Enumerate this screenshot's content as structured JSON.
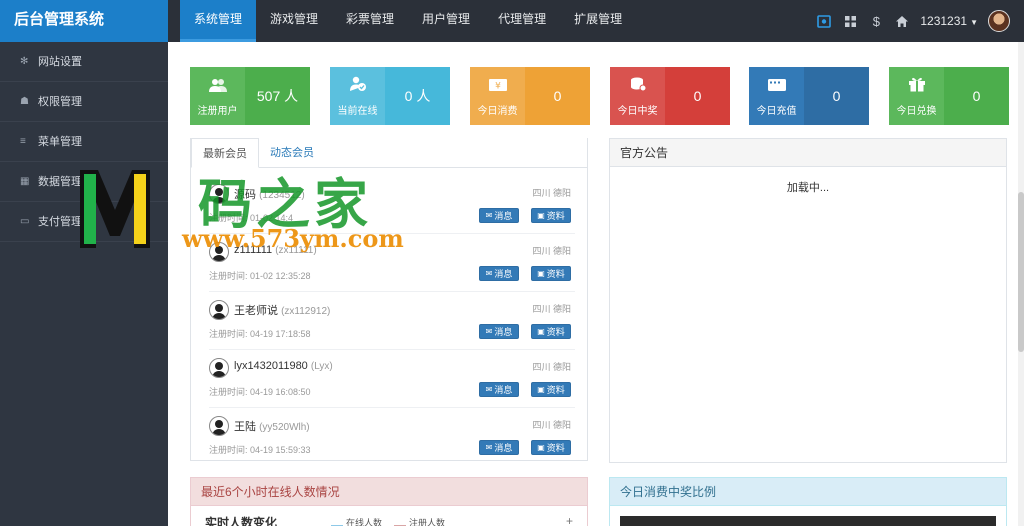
{
  "app": {
    "title": "后台管理系统"
  },
  "nav": {
    "items": [
      {
        "label": "系统管理",
        "active": true
      },
      {
        "label": "游戏管理",
        "active": false
      },
      {
        "label": "彩票管理",
        "active": false
      },
      {
        "label": "用户管理",
        "active": false
      },
      {
        "label": "代理管理",
        "active": false
      },
      {
        "label": "扩展管理",
        "active": false
      }
    ]
  },
  "topbar": {
    "icons": [
      "monitor-icon",
      "gift-icon",
      "dollar-icon",
      "home-icon"
    ],
    "username": "1231231"
  },
  "sidebar": {
    "items": [
      {
        "label": "网站设置",
        "icon": "gear-icon"
      },
      {
        "label": "权限管理",
        "icon": "users-icon"
      },
      {
        "label": "菜单管理",
        "icon": "list-icon"
      },
      {
        "label": "数据管理",
        "icon": "table-icon"
      },
      {
        "label": "支付管理",
        "icon": "card-icon"
      }
    ]
  },
  "stats": [
    {
      "label": "注册用户",
      "value": "507 人",
      "icon": "users-icon",
      "color_left": "#5cb85c",
      "color_right": "#4cae4c"
    },
    {
      "label": "当前在线",
      "value": "0 人",
      "icon": "user-check-icon",
      "color_left": "#5bc0de",
      "color_right": "#46b8da"
    },
    {
      "label": "今日消费",
      "value": "0",
      "icon": "ticket-icon",
      "color_left": "#f0ad4e",
      "color_right": "#eea236"
    },
    {
      "label": "今日中奖",
      "value": "0",
      "icon": "coins-icon",
      "color_left": "#d9534f",
      "color_right": "#d43f3a"
    },
    {
      "label": "今日充值",
      "value": "0",
      "icon": "wallet-icon",
      "color_left": "#337ab7",
      "color_right": "#2e6da4"
    },
    {
      "label": "今日兑换",
      "value": "0",
      "icon": "gift-icon",
      "color_left": "#5cb85c",
      "color_right": "#4cae4c"
    }
  ],
  "members_panel": {
    "tabs": [
      {
        "label": "最新会员",
        "active": true
      },
      {
        "label": "动态会员",
        "active": false
      }
    ],
    "msg_label": "消息",
    "info_label": "资料",
    "rows": [
      {
        "name": "源码",
        "account": "(1234512)",
        "location": "四川 德阳",
        "time": "注册时间: 01-02 14:4"
      },
      {
        "name": "z111111",
        "account": "(zx11111)",
        "location": "四川 德阳",
        "time": "注册时间: 01-02 12:35:28"
      },
      {
        "name": "王老师说",
        "account": "(zx112912)",
        "location": "四川 德阳",
        "time": "注册时间: 04-19 17:18:58"
      },
      {
        "name": "lyx1432011980",
        "account": "(Lyx)",
        "location": "四川 德阳",
        "time": "注册时间: 04-19 16:08:50"
      },
      {
        "name": "王陆",
        "account": "(yy520Wlh)",
        "location": "四川 德阳",
        "time": "注册时间: 04-19 15:59:33"
      }
    ]
  },
  "notice_panel": {
    "title": "官方公告",
    "status": "加载中..."
  },
  "online_panel": {
    "title": "最近6个小时在线人数情况",
    "chart_title": "实时人数变化",
    "legend": [
      "在线人数",
      "注册人数"
    ],
    "header_color": "#f2dede"
  },
  "ratio_panel": {
    "title": "今日消费中奖比例",
    "header_color": "#d9edf7"
  },
  "watermark": {
    "text": "码之家",
    "url": "www.573ym.com"
  }
}
